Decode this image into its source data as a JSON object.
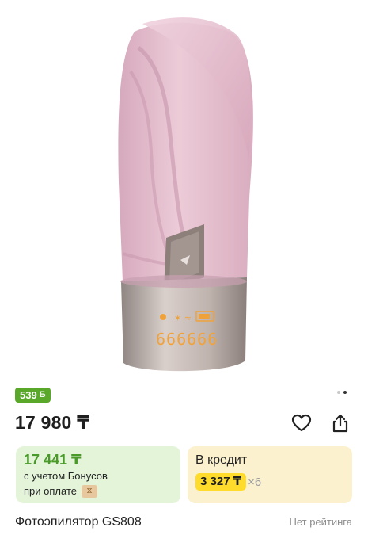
{
  "product": {
    "image_alt_icon": "ipl-epilator-device",
    "display_digits": "666666",
    "title": "Фотоэпилятор GS808",
    "rating_text": "Нет рейтинга"
  },
  "gallery": {
    "pages": 2,
    "active_page": 1
  },
  "bonus_badge": {
    "text": "539",
    "icon": "bonus-b-icon"
  },
  "price": {
    "text": "17 980 ₸"
  },
  "actions": {
    "favorite_icon": "heart-icon",
    "share_icon": "share-icon"
  },
  "bonus_card": {
    "price": "17 441 ₸",
    "line1": "с учетом Бонусов",
    "line2": "при оплате",
    "badge_icon": "bonus-card-icon"
  },
  "credit_card": {
    "title": "В кредит",
    "monthly": "3 327 ₸",
    "months": "×6"
  },
  "colors": {
    "accent_green": "#5aa82a",
    "bonus_bg": "#e3f4d9",
    "credit_bg": "#fbf1cf",
    "monthly_highlight": "#ffdc2c"
  }
}
